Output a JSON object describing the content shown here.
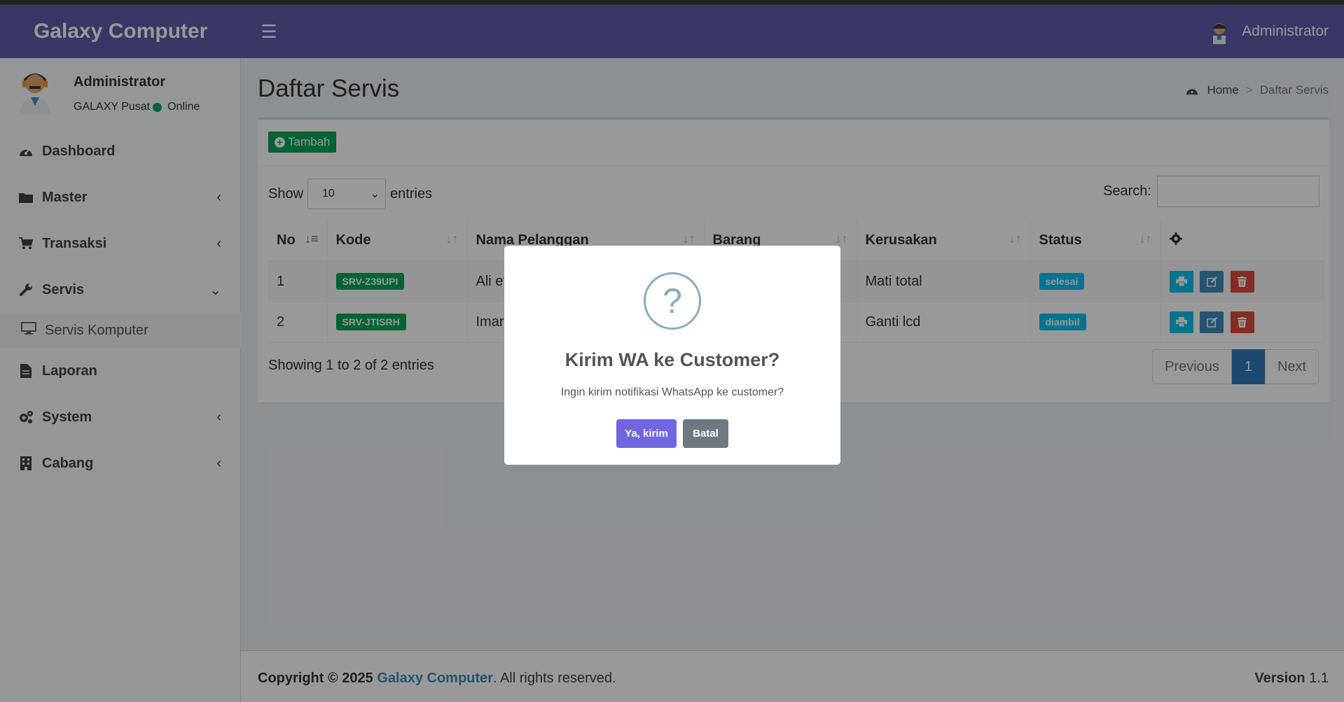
{
  "app": {
    "brand": "Galaxy Computer",
    "menu_toggle_icon": "hamburger-icon"
  },
  "header": {
    "user_name": "Administrator"
  },
  "user_panel": {
    "name": "Administrator",
    "branch": "GALAXY Pusat",
    "status": "Online",
    "status_color": "#00a65a"
  },
  "sidebar": {
    "items": [
      {
        "label": "Dashboard",
        "icon": "dashboard-icon"
      },
      {
        "label": "Master",
        "icon": "folder-icon"
      },
      {
        "label": "Transaksi",
        "icon": "cart-icon"
      },
      {
        "label": "Servis",
        "icon": "wrench-icon"
      },
      {
        "label": "Laporan",
        "icon": "file-icon"
      },
      {
        "label": "System",
        "icon": "gears-icon"
      },
      {
        "label": "Cabang",
        "icon": "building-icon"
      }
    ],
    "servis_sub": {
      "label": "Servis Komputer",
      "icon": "desktop-icon"
    }
  },
  "page": {
    "title": "Daftar Servis",
    "breadcrumb_home": "Home",
    "breadcrumb_current": "Daftar Servis"
  },
  "toolbar": {
    "add_label": "Tambah"
  },
  "table_controls": {
    "show_label": "Show",
    "length_value": "10",
    "entries_label": "entries",
    "search_label": "Search:"
  },
  "table": {
    "columns": [
      "No",
      "Kode",
      "Nama Pelanggan",
      "Barang",
      "Kerusakan",
      "Status"
    ],
    "rows": [
      {
        "no": "1",
        "kode": "SRV-Z39UPI",
        "nama": "Ali ef",
        "barang": "",
        "kerusakan": "Mati total",
        "status": "selesai"
      },
      {
        "no": "2",
        "kode": "SRV-JTISRH",
        "nama": "Imar",
        "barang": "",
        "kerusakan": "Ganti lcd",
        "status": "diambil"
      }
    ]
  },
  "pagination": {
    "info": "Showing 1 to 2 of 2 entries",
    "prev": "Previous",
    "current": "1",
    "next": "Next"
  },
  "footer": {
    "copyright_prefix": "Copyright © 2025",
    "brand": "Galaxy Computer",
    "rights": ". All rights reserved.",
    "version_label": "Version",
    "version": "1.1"
  },
  "dialog": {
    "icon": "question-icon",
    "title": "Kirim WA ke Customer?",
    "text": "Ingin kirim notifikasi WhatsApp ke customer?",
    "confirm": "Ya, kirim",
    "cancel": "Batal"
  },
  "colors": {
    "header": "#605ca8",
    "success": "#00a65a",
    "info": "#00c0ef",
    "primary": "#3c8dbc",
    "danger": "#dd4b39",
    "confirm": "#7066e0",
    "cancel": "#6e7881"
  }
}
